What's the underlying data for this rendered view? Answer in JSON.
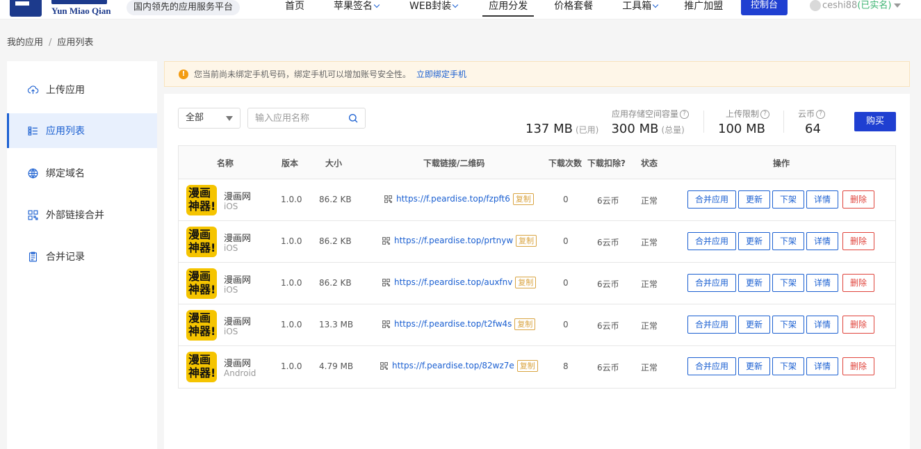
{
  "header": {
    "logo_text": "Yun Miao Qian",
    "slogan": "国内领先的应用服务平台",
    "nav": [
      {
        "label": "首页",
        "has_dropdown": false,
        "active": false
      },
      {
        "label": "苹果签名",
        "has_dropdown": true,
        "active": false
      },
      {
        "label": "WEB封装",
        "has_dropdown": true,
        "active": false
      },
      {
        "label": "应用分发",
        "has_dropdown": false,
        "active": true
      },
      {
        "label": "价格套餐",
        "has_dropdown": false,
        "active": false
      },
      {
        "label": "工具箱",
        "has_dropdown": true,
        "active": false
      },
      {
        "label": "推广加盟",
        "has_dropdown": false,
        "active": false
      }
    ],
    "console_label": "控制台",
    "user": {
      "name": "ceshi88",
      "status": "(已实名)"
    }
  },
  "breadcrumb": {
    "items": [
      "我的应用",
      "应用列表"
    ],
    "separator": "/"
  },
  "sidebar": {
    "items": [
      {
        "label": "上传应用",
        "icon": "cloud-upload-icon",
        "active": false
      },
      {
        "label": "应用列表",
        "icon": "list-icon",
        "active": true
      },
      {
        "label": "绑定域名",
        "icon": "globe-icon",
        "active": false
      },
      {
        "label": "外部链接合并",
        "icon": "qrcode-icon",
        "active": false
      },
      {
        "label": "合并记录",
        "icon": "clipboard-icon",
        "active": false
      }
    ]
  },
  "alert": {
    "text": "您当前尚未绑定手机号码，绑定手机可以增加账号安全性。",
    "link": "立即绑定手机"
  },
  "toolbar": {
    "filter_value": "全部",
    "search_placeholder": "输入应用名称"
  },
  "stats": {
    "storage_label": "应用存储空间容量",
    "used_value": "137 MB",
    "used_suffix": "(已用)",
    "total_value": "300 MB",
    "total_suffix": "(总量)",
    "upload_label": "上传限制",
    "upload_value": "100 MB",
    "coin_label": "云币",
    "coin_value": "64",
    "buy_label": "购买"
  },
  "table": {
    "headers": {
      "name": "名称",
      "version": "版本",
      "size": "大小",
      "link": "下载链接/二维码",
      "downloads": "下载次数",
      "deduction": "下载扣除?",
      "status": "状态",
      "actions": "操作"
    },
    "copy_label": "复制",
    "action_labels": {
      "merge": "合并应用",
      "update": "更新",
      "unlist": "下架",
      "detail": "详情",
      "delete": "删除"
    },
    "rows": [
      {
        "icon_line1": "漫画",
        "icon_line2": "神器!",
        "name": "漫画网",
        "platform": "iOS",
        "version": "1.0.0",
        "size": "86.2 KB",
        "link": "https://f.peardise.top/fzpft6",
        "downloads": "0",
        "deduction": "6云币",
        "status": "正常"
      },
      {
        "icon_line1": "漫画",
        "icon_line2": "神器!",
        "name": "漫画网",
        "platform": "iOS",
        "version": "1.0.0",
        "size": "86.2 KB",
        "link": "https://f.peardise.top/prtnyw",
        "downloads": "0",
        "deduction": "6云币",
        "status": "正常"
      },
      {
        "icon_line1": "漫画",
        "icon_line2": "神器!",
        "name": "漫画网",
        "platform": "iOS",
        "version": "1.0.0",
        "size": "86.2 KB",
        "link": "https://f.peardise.top/auxfnv",
        "downloads": "0",
        "deduction": "6云币",
        "status": "正常"
      },
      {
        "icon_line1": "漫画",
        "icon_line2": "神器!",
        "name": "漫画网",
        "platform": "iOS",
        "version": "1.0.0",
        "size": "13.3 MB",
        "link": "https://f.peardise.top/t2fw4s",
        "downloads": "0",
        "deduction": "6云币",
        "status": "正常"
      },
      {
        "icon_line1": "漫画",
        "icon_line2": "神器!",
        "name": "漫画网",
        "platform": "Android",
        "version": "1.0.0",
        "size": "4.79 MB",
        "link": "https://f.peardise.top/82wz7e",
        "downloads": "8",
        "deduction": "6云币",
        "status": "正常"
      }
    ]
  },
  "colors": {
    "primary": "#1f3fd1",
    "link": "#1a5fd1",
    "danger": "#e0443c",
    "copy": "#d9a441",
    "app_icon_bg": "#f5c400"
  }
}
